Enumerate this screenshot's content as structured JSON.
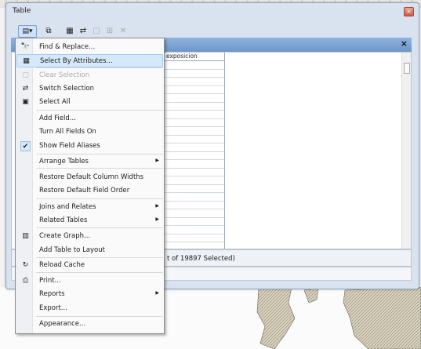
{
  "window": {
    "title": "Table",
    "close_glyph": "×"
  },
  "toolbar": {
    "options_glyph": "▤▾",
    "buttons": [
      {
        "name": "related-tables-icon",
        "glyph": "⧉"
      },
      {
        "name": "select-by-attributes-icon",
        "glyph": "▦"
      },
      {
        "name": "switch-selection-icon",
        "glyph": "⇄"
      },
      {
        "name": "clear-selection-icon",
        "glyph": "▢"
      },
      {
        "name": "zoom-to-selected-icon",
        "glyph": "⊞"
      },
      {
        "name": "delete-selected-icon",
        "glyph": "✕"
      }
    ]
  },
  "table": {
    "tab_close_glyph": "×",
    "column_header": "exposicion",
    "status": "t of 19897 Selected)"
  },
  "menu": {
    "items": [
      {
        "label": "Find & Replace...",
        "icon": "find-binoculars-icon",
        "glyph": "🔭"
      },
      {
        "label": "Select By Attributes...",
        "icon": "select-by-attributes-icon",
        "glyph": "▦"
      },
      {
        "label": "Clear Selection",
        "icon": "clear-selection-icon",
        "glyph": "▢"
      },
      {
        "label": "Switch Selection",
        "icon": "switch-selection-icon",
        "glyph": "⇄"
      },
      {
        "label": "Select All",
        "icon": "select-all-icon",
        "glyph": "▣"
      },
      {
        "label": "Add Field..."
      },
      {
        "label": "Turn All Fields On"
      },
      {
        "label": "Show Field Aliases",
        "icon": "checkmark-icon",
        "glyph": "✔"
      },
      {
        "label": "Arrange Tables",
        "submenu": "▶"
      },
      {
        "label": "Restore Default Column Widths"
      },
      {
        "label": "Restore Default Field Order"
      },
      {
        "label": "Joins and Relates",
        "submenu": "▶"
      },
      {
        "label": "Related Tables",
        "submenu": "▶"
      },
      {
        "label": "Create Graph...",
        "icon": "bar-chart-icon",
        "glyph": "▥"
      },
      {
        "label": "Add Table to Layout"
      },
      {
        "label": "Reload Cache",
        "icon": "reload-icon",
        "glyph": "↻"
      },
      {
        "label": "Print...",
        "icon": "printer-icon",
        "glyph": "⎙"
      },
      {
        "label": "Reports",
        "submenu": "▶"
      },
      {
        "label": "Export..."
      },
      {
        "label": "Appearance..."
      }
    ]
  },
  "colors": {
    "highlight": "#d6e8fb",
    "tab_blue": "#7aa2d2",
    "map_fill": "#d8d2bf"
  }
}
